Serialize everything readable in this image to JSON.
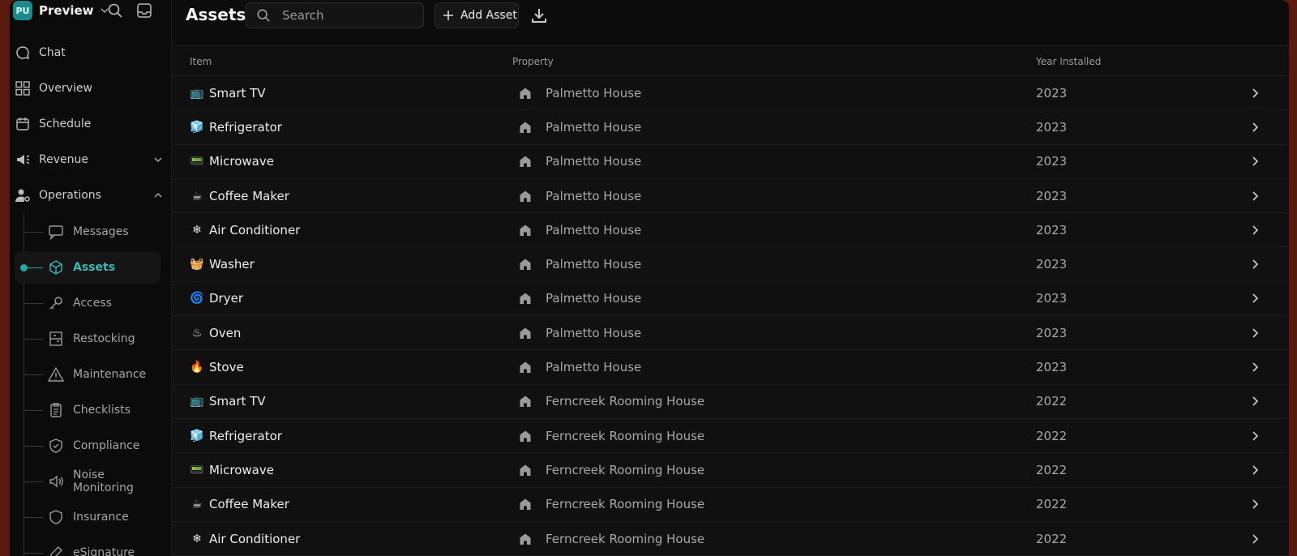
{
  "workspace": {
    "initials": "PU",
    "name": "Preview"
  },
  "nav": [
    {
      "label": "Chat",
      "icon": "chat-bubble-icon"
    },
    {
      "label": "Overview",
      "icon": "grid-icon"
    },
    {
      "label": "Schedule",
      "icon": "calendar-icon"
    },
    {
      "label": "Revenue",
      "icon": "megaphone-icon"
    },
    {
      "label": "Operations",
      "icon": "user-gear-icon"
    }
  ],
  "sub_nav": [
    {
      "label": "Messages",
      "icon": "message-icon"
    },
    {
      "label": "Assets",
      "icon": "cube-icon",
      "active": true
    },
    {
      "label": "Access",
      "icon": "key-icon"
    },
    {
      "label": "Restocking",
      "icon": "shelf-icon"
    },
    {
      "label": "Maintenance",
      "icon": "warning-icon"
    },
    {
      "label": "Checklists",
      "icon": "clipboard-icon"
    },
    {
      "label": "Compliance",
      "icon": "shield-check-icon"
    },
    {
      "label": "Noise Monitoring",
      "icon": "speaker-icon"
    },
    {
      "label": "Insurance",
      "icon": "shield-icon"
    },
    {
      "label": "eSignature",
      "icon": "pen-icon"
    }
  ],
  "page": {
    "title": "Assets",
    "search_placeholder": "Search",
    "add_label": "Add Asset"
  },
  "table": {
    "columns": [
      "Item",
      "Property",
      "Year Installed"
    ],
    "rows": [
      {
        "emoji": "📺",
        "item": "Smart TV",
        "property": "Palmetto House",
        "year": "2023"
      },
      {
        "emoji": "🧊",
        "item": "Refrigerator",
        "property": "Palmetto House",
        "year": "2023"
      },
      {
        "emoji": "📟",
        "item": "Microwave",
        "property": "Palmetto House",
        "year": "2023"
      },
      {
        "emoji": "☕",
        "item": "Coffee Maker",
        "property": "Palmetto House",
        "year": "2023"
      },
      {
        "emoji": "❄",
        "item": "Air Conditioner",
        "property": "Palmetto House",
        "year": "2023"
      },
      {
        "emoji": "🧺",
        "item": "Washer",
        "property": "Palmetto House",
        "year": "2023"
      },
      {
        "emoji": "🌀",
        "item": "Dryer",
        "property": "Palmetto House",
        "year": "2023"
      },
      {
        "emoji": "♨",
        "item": "Oven",
        "property": "Palmetto House",
        "year": "2023"
      },
      {
        "emoji": "🔥",
        "item": "Stove",
        "property": "Palmetto House",
        "year": "2023"
      },
      {
        "emoji": "📺",
        "item": "Smart TV",
        "property": "Ferncreek Rooming House",
        "year": "2022"
      },
      {
        "emoji": "🧊",
        "item": "Refrigerator",
        "property": "Ferncreek Rooming House",
        "year": "2022"
      },
      {
        "emoji": "📟",
        "item": "Microwave",
        "property": "Ferncreek Rooming House",
        "year": "2022"
      },
      {
        "emoji": "☕",
        "item": "Coffee Maker",
        "property": "Ferncreek Rooming House",
        "year": "2022"
      },
      {
        "emoji": "❄",
        "item": "Air Conditioner",
        "property": "Ferncreek Rooming House",
        "year": "2022"
      }
    ]
  },
  "colors": {
    "accent": "#2aa6a3",
    "background": "#0b0b0b",
    "frame": "#5a1a10"
  }
}
